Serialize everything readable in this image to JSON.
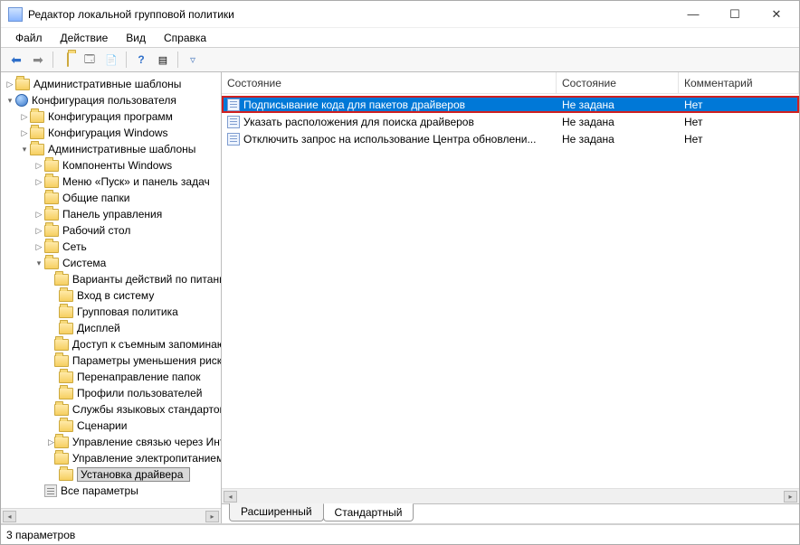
{
  "window": {
    "title": "Редактор локальной групповой политики"
  },
  "title_buttons": {
    "min": "—",
    "max": "☐",
    "close": "✕"
  },
  "menu": {
    "file": "Файл",
    "action": "Действие",
    "view": "Вид",
    "help": "Справка"
  },
  "toolbar_icons": {
    "back": "⇦",
    "forward": "⇨",
    "up": "📁",
    "props": "📋",
    "refresh": "⟳",
    "export": "📄",
    "help": "?",
    "list": "⊞",
    "filter": "▽"
  },
  "tree": {
    "admin_templates": "Административные шаблоны",
    "user_config": "Конфигурация пользователя",
    "software_config": "Конфигурация программ",
    "windows_config": "Конфигурация Windows",
    "admin_templates2": "Административные шаблоны",
    "win_components": "Компоненты Windows",
    "start_menu": "Меню «Пуск» и панель задач",
    "shared_folders": "Общие папки",
    "control_panel": "Панель управления",
    "desktop": "Рабочий стол",
    "network": "Сеть",
    "system": "Система",
    "power_options": "Варианты действий по питанию",
    "logon": "Вход в систему",
    "group_policy": "Групповая политика",
    "display": "Дисплей",
    "removable": "Доступ к съемным запоминающим устройствам",
    "mitigation": "Параметры уменьшения рисков",
    "folder_redirect": "Перенаправление папок",
    "user_profiles": "Профили пользователей",
    "locale": "Службы языковых стандартов",
    "scripts": "Сценарии",
    "ctrlaltdel": "Управление связью через Интернет",
    "power_mgmt": "Управление электропитанием",
    "driver_install": "Установка драйвера",
    "all_settings": "Все параметры"
  },
  "columns": {
    "name": "Состояние",
    "state": "Состояние",
    "comment": "Комментарий"
  },
  "rows": [
    {
      "name": "Подписывание кода для пакетов драйверов",
      "state": "Не задана",
      "comment": "Нет",
      "selected": true
    },
    {
      "name": "Указать расположения для поиска драйверов",
      "state": "Не задана",
      "comment": "Нет",
      "selected": false
    },
    {
      "name": "Отключить запрос на использование Центра обновлени...",
      "state": "Не задана",
      "comment": "Нет",
      "selected": false
    }
  ],
  "tabs": {
    "extended": "Расширенный",
    "standard": "Стандартный"
  },
  "status": "3 параметров"
}
